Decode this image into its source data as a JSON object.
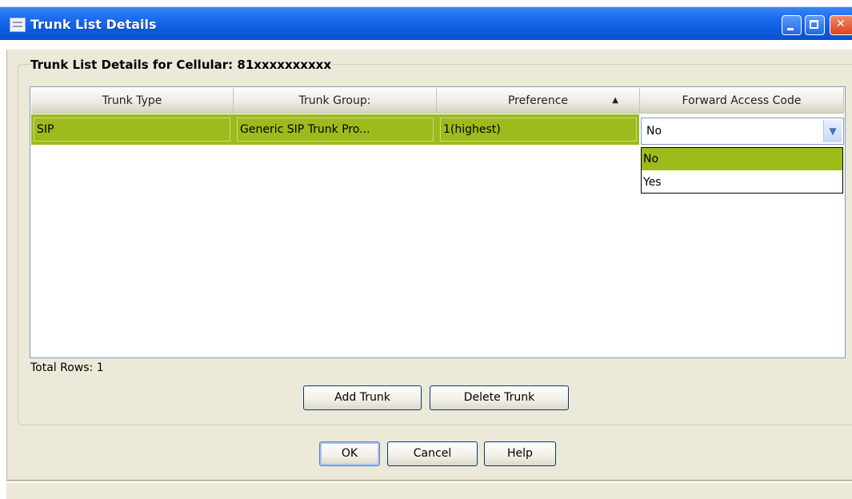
{
  "window": {
    "title": "Trunk List Details"
  },
  "group": {
    "title": "Trunk List Details for Cellular: 81xxxxxxxxxx"
  },
  "table": {
    "columns": [
      "Trunk Type",
      "Trunk Group:",
      "Preference",
      "Forward Access Code"
    ],
    "sort_indicator": "▲",
    "rows": [
      {
        "trunk_type": "SIP",
        "trunk_group": "Generic SIP Trunk Pro...",
        "preference": "1(highest)",
        "forward_access_code": "No"
      }
    ],
    "forward_access_code_options": [
      "No",
      "Yes"
    ],
    "total_rows_label": "Total Rows: 1"
  },
  "buttons": {
    "add_trunk": "Add Trunk",
    "delete_trunk": "Delete Trunk",
    "ok": "OK",
    "cancel": "Cancel",
    "help": "Help"
  },
  "colors": {
    "selection": "#9dbb1a",
    "titlebar": "#0a50cf"
  },
  "icons": {
    "window": "window-icon",
    "minimize": "minimize-icon",
    "maximize": "maximize-icon",
    "close": "close-icon",
    "dropdown": "chevron-down-icon",
    "sort": "sort-ascending-icon"
  }
}
